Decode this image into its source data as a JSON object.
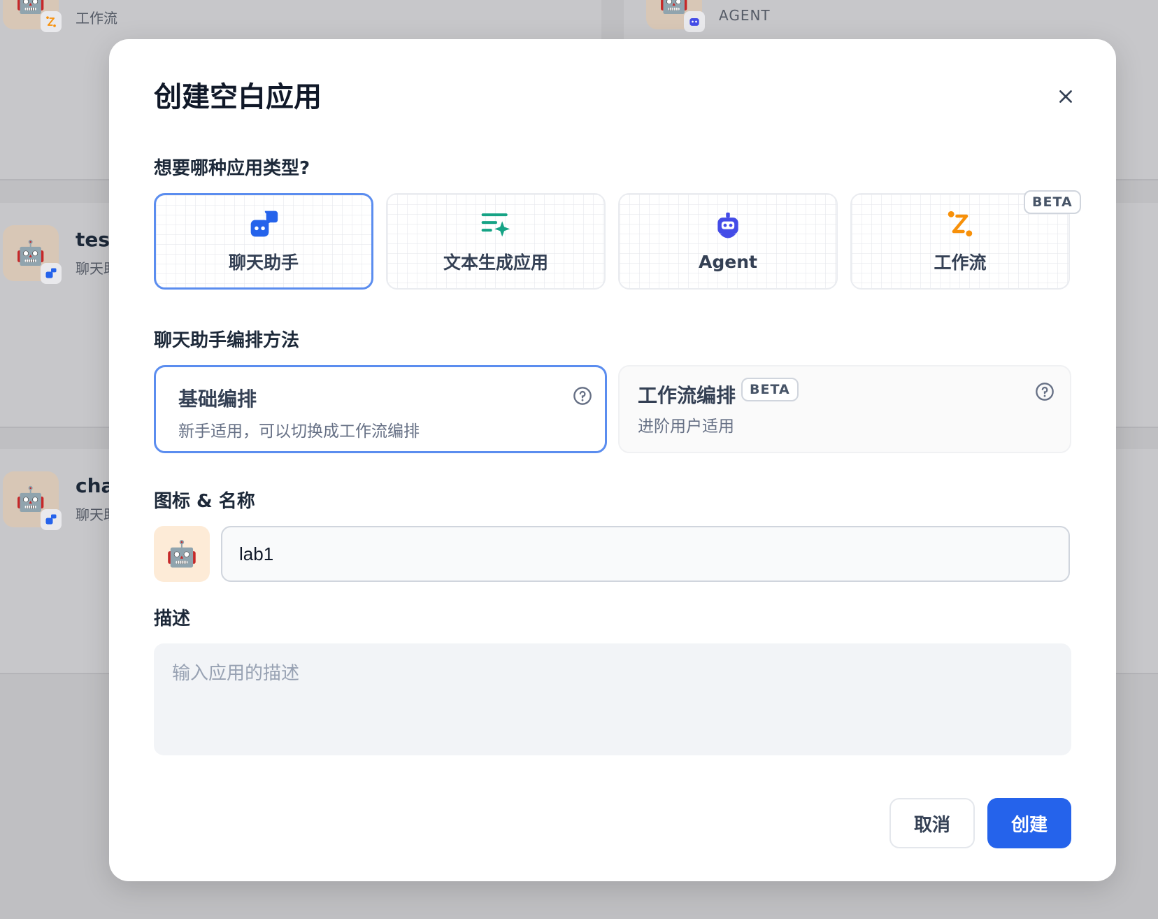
{
  "background": {
    "cards": [
      {
        "title": "",
        "subtitle": "工作流"
      },
      {
        "title": "",
        "subtitle": "AGENT"
      },
      {
        "title": "test",
        "subtitle": "聊天助"
      },
      {
        "title": "cha",
        "subtitle": "聊天助"
      }
    ]
  },
  "modal": {
    "title": "创建空白应用",
    "type_question": "想要哪种应用类型?",
    "app_types": [
      {
        "label": "聊天助手",
        "icon": "chat-bot-icon",
        "selected": true
      },
      {
        "label": "文本生成应用",
        "icon": "text-generation-icon",
        "selected": false
      },
      {
        "label": "Agent",
        "icon": "agent-robot-icon",
        "selected": false
      },
      {
        "label": "工作流",
        "icon": "workflow-icon",
        "selected": false,
        "badge": "BETA"
      }
    ],
    "orchestration_label": "聊天助手编排方法",
    "modes": [
      {
        "title": "基础编排",
        "description": "新手适用，可以切换成工作流编排",
        "selected": true
      },
      {
        "title": "工作流编排",
        "badge": "BETA",
        "description": "进阶用户适用",
        "selected": false
      }
    ],
    "icon_name_label": "图标 & 名称",
    "app_icon": "🤖",
    "name_value": "lab1",
    "description_label": "描述",
    "description_placeholder": "输入应用的描述",
    "cancel_label": "取消",
    "create_label": "创建"
  },
  "colors": {
    "accent": "#2563eb",
    "selected_border": "#5b8def",
    "workflow_orange": "#f79009",
    "text_gen_teal": "#16a385",
    "agent_indigo": "#444ce7"
  }
}
